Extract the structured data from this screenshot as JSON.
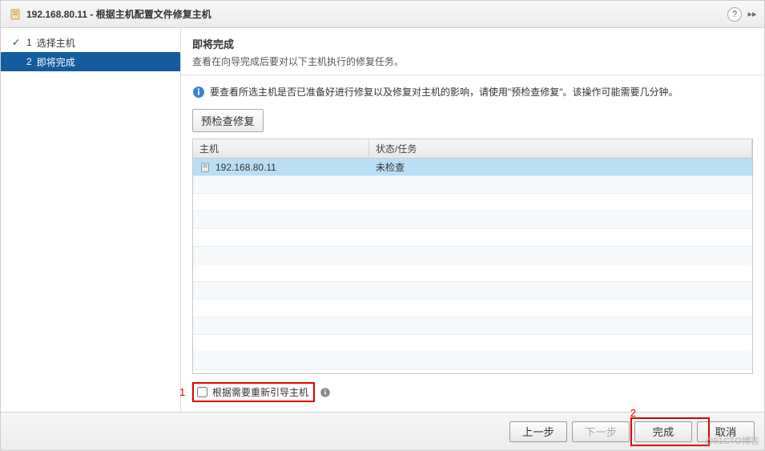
{
  "titlebar": {
    "host_ip": "192.168.80.11",
    "title_suffix": " - 根据主机配置文件修复主机"
  },
  "wizard": {
    "steps": [
      {
        "num": "1",
        "label": "选择主机",
        "done": true,
        "active": false
      },
      {
        "num": "2",
        "label": "即将完成",
        "done": false,
        "active": true
      }
    ]
  },
  "content": {
    "heading": "即将完成",
    "subheading": "查看在向导完成后要对以下主机执行的修复任务。",
    "info_text": "要查看所选主机是否已准备好进行修复以及修复对主机的影响，请使用\"预检查修复\"。该操作可能需要几分钟。",
    "precheck_label": "预检查修复"
  },
  "table": {
    "columns": {
      "host": "主机",
      "status": "状态/任务"
    },
    "rows": [
      {
        "host": "192.168.80.11",
        "status": "未检查"
      }
    ]
  },
  "reboot": {
    "checkbox_label": "根据需要重新引导主机"
  },
  "footer": {
    "back": "上一步",
    "next": "下一步",
    "finish": "完成",
    "cancel": "取消"
  },
  "annotations": {
    "one": "1",
    "two": "2"
  },
  "watermark": "@51CTO博客"
}
